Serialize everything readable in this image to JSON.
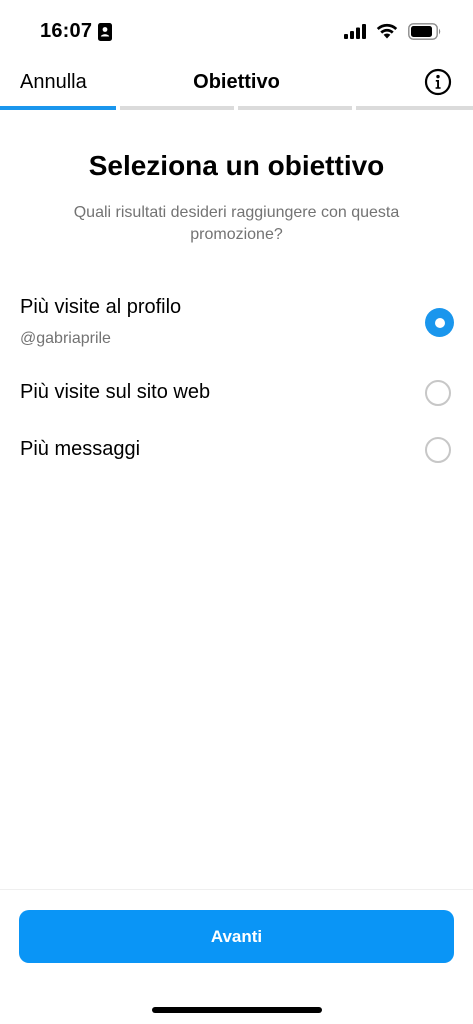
{
  "status_bar": {
    "time": "16:07",
    "icons": [
      "id-card-icon",
      "cellular-signal-icon",
      "wifi-icon",
      "battery-icon"
    ]
  },
  "header": {
    "cancel_label": "Annulla",
    "title": "Obiettivo",
    "info_icon": "info-icon"
  },
  "progress": {
    "total_steps": 4,
    "current_step": 1
  },
  "main": {
    "heading": "Seleziona un obiettivo",
    "subheading": "Quali risultati desideri raggiungere con questa promozione?",
    "options": [
      {
        "label": "Più visite al profilo",
        "sublabel": "@gabriaprile",
        "selected": true
      },
      {
        "label": "Più visite sul sito web",
        "selected": false
      },
      {
        "label": "Più messaggi",
        "selected": false
      }
    ]
  },
  "footer": {
    "next_label": "Avanti"
  },
  "colors": {
    "accent": "#0a95f6",
    "progress_active": "#1a96ed",
    "progress_inactive": "#dbdbdb",
    "secondary_text": "#737373",
    "radio_border": "#c7c7c7"
  }
}
